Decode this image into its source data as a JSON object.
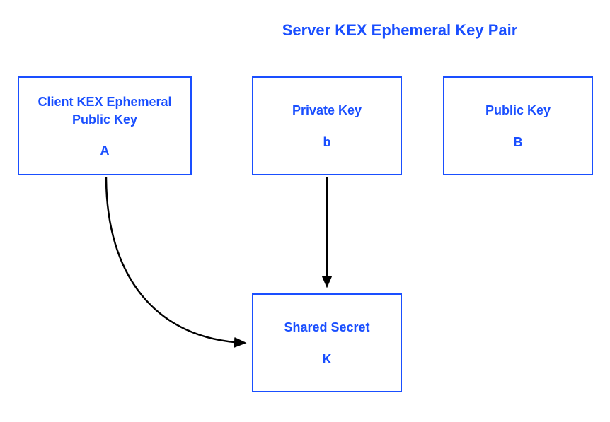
{
  "title": "Server KEX Ephemeral Key Pair",
  "boxes": {
    "client_pub": {
      "label": "Client KEX Ephemeral Public Key",
      "symbol": "A"
    },
    "private": {
      "label": "Private Key",
      "symbol": "b"
    },
    "public": {
      "label": "Public Key",
      "symbol": "B"
    },
    "shared": {
      "label": "Shared Secret",
      "symbol": "K"
    }
  }
}
